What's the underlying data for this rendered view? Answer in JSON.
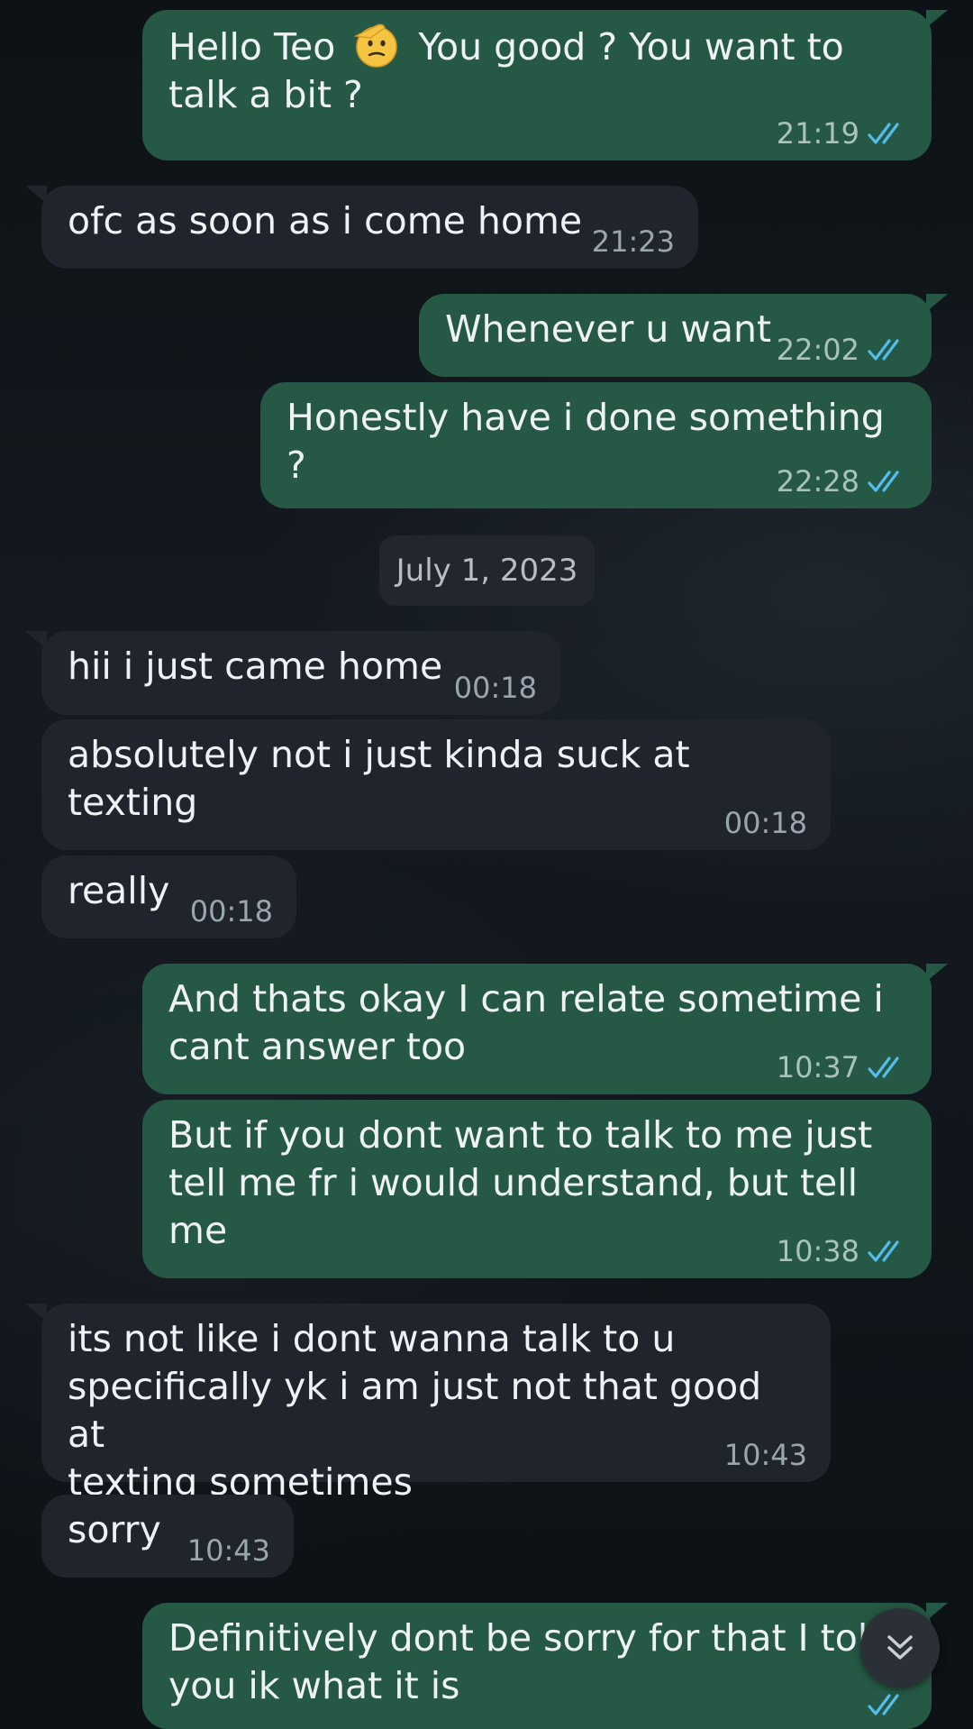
{
  "messages": [
    {
      "dir": "out",
      "text_before": "Hello Teo ",
      "emoji": "saluting-face",
      "text_after": " You good ? You want to\ntalk a bit ?",
      "time": "21:19",
      "status": "read"
    },
    {
      "dir": "in",
      "text": "ofc as soon as i come home",
      "time": "21:23"
    },
    {
      "dir": "out",
      "text": "Whenever u want",
      "time": "22:02",
      "status": "read"
    },
    {
      "dir": "out",
      "text": "Honestly have i done something ?",
      "time": "22:28",
      "status": "read"
    },
    {
      "dir": "in",
      "text": "hii i just came home",
      "time": "00:18"
    },
    {
      "dir": "in",
      "text": "absolutely not i just kinda suck at\ntexting",
      "time": "00:18"
    },
    {
      "dir": "in",
      "text": "really",
      "time": "00:18"
    },
    {
      "dir": "out",
      "text": "And thats okay I can relate sometime i\ncant answer too",
      "time": "10:37",
      "status": "read"
    },
    {
      "dir": "out",
      "text": "But if you dont want to talk to me just\ntell me fr i would understand, but tell\nme",
      "time": "10:38",
      "status": "read"
    },
    {
      "dir": "in",
      "text": "its not like i dont wanna talk to u\nspecifically yk i am just not that good at\ntexting sometimes",
      "time": "10:43"
    },
    {
      "dir": "in",
      "text": "sorry",
      "time": "10:43"
    },
    {
      "dir": "out",
      "text": "Definitively dont be sorry for that I tol\nyou ik what it is",
      "time": "",
      "status": "read"
    }
  ],
  "date_separator": "July 1, 2023",
  "colors": {
    "outgoing_bubble": "#265846",
    "incoming_bubble": "#20252d",
    "read_ticks": "#53bdeb",
    "background": "#10161b"
  },
  "icons": {
    "read_receipt": "double-check-icon",
    "scroll_down": "double-chevron-down-icon"
  }
}
